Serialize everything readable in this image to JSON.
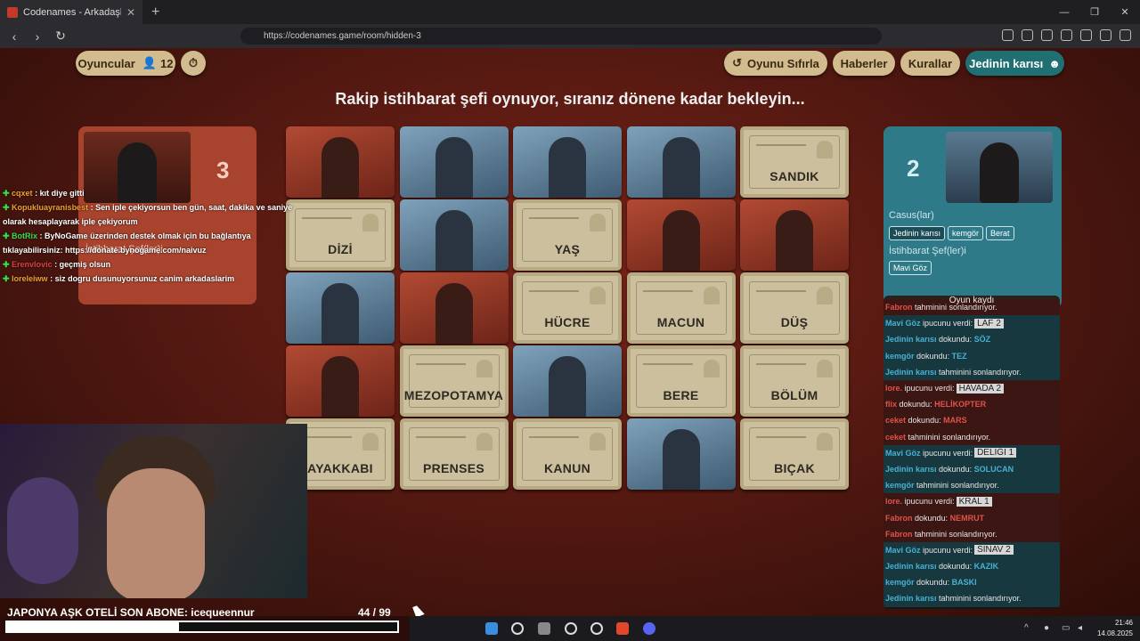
{
  "browser": {
    "tab_title": "Codenames - Arkadaşlarınızla ç",
    "url": "https://codenames.game/room/hidden-3"
  },
  "header": {
    "players_label": "Oyuncular",
    "players_count": "12",
    "reset_label": "Oyunu Sıfırla",
    "news_label": "Haberler",
    "rules_label": "Kurallar",
    "user_label": "Jedinin karısı"
  },
  "status_text": "Rakip istihbarat şefi oynuyor, sıranız dönene kadar bekleyin...",
  "red_team": {
    "count": "3",
    "spymasters_label": "İstihbarat Şef(ler)i"
  },
  "blue_team": {
    "count": "2",
    "operatives_label": "Casus(lar)",
    "operatives": [
      "Jedinin karısı",
      "kemgör",
      "Berat"
    ],
    "spymasters_label": "İstihbarat Şef(ler)i",
    "spymasters": [
      "Mavi Göz"
    ]
  },
  "board": [
    {
      "type": "agent-red",
      "word": ""
    },
    {
      "type": "agent-blue",
      "word": ""
    },
    {
      "type": "agent-blue",
      "word": ""
    },
    {
      "type": "agent-blue",
      "word": ""
    },
    {
      "type": "word",
      "word": "SANDIK"
    },
    {
      "type": "word",
      "word": "DİZİ"
    },
    {
      "type": "agent-blue",
      "word": ""
    },
    {
      "type": "word",
      "word": "YAŞ"
    },
    {
      "type": "agent-red",
      "word": ""
    },
    {
      "type": "agent-red",
      "word": ""
    },
    {
      "type": "agent-blue",
      "word": ""
    },
    {
      "type": "agent-red",
      "word": ""
    },
    {
      "type": "word",
      "word": "HÜCRE"
    },
    {
      "type": "word",
      "word": "MACUN"
    },
    {
      "type": "word",
      "word": "DÜŞ"
    },
    {
      "type": "agent-red",
      "word": ""
    },
    {
      "type": "word",
      "word": "MEZOPOTAMYA"
    },
    {
      "type": "agent-blue",
      "word": ""
    },
    {
      "type": "word",
      "word": "BERE"
    },
    {
      "type": "word",
      "word": "BÖLÜM"
    },
    {
      "type": "word",
      "word": "AYAKKABI"
    },
    {
      "type": "word",
      "word": "PRENSES"
    },
    {
      "type": "word",
      "word": "KANUN"
    },
    {
      "type": "agent-blue",
      "word": ""
    },
    {
      "type": "word",
      "word": "BIÇAK"
    }
  ],
  "log": {
    "title": "Oyun kaydı",
    "rows": [
      {
        "team": "red",
        "player": "Fabron",
        "action": "tahminini sonlandırıyor.",
        "word": "",
        "hint": ""
      },
      {
        "team": "blue",
        "player": "Mavi Göz",
        "action": "ipucunu verdi:",
        "word": "",
        "hint": "LAF 2"
      },
      {
        "team": "blue",
        "player": "Jedinin karısı",
        "action": "dokundu:",
        "word": "SÖZ",
        "hint": ""
      },
      {
        "team": "blue",
        "player": "kemgör",
        "action": "dokundu:",
        "word": "TEZ",
        "hint": ""
      },
      {
        "team": "blue",
        "player": "Jedinin karısı",
        "action": "tahminini sonlandırıyor.",
        "word": "",
        "hint": ""
      },
      {
        "team": "red",
        "player": "lore.",
        "action": "ipucunu verdi:",
        "word": "",
        "hint": "HAVADA 2"
      },
      {
        "team": "red",
        "player": "flix",
        "action": "dokundu:",
        "word": "HELİKOPTER",
        "hint": ""
      },
      {
        "team": "red",
        "player": "ceket",
        "action": "dokundu:",
        "word": "MARS",
        "hint": ""
      },
      {
        "team": "red",
        "player": "ceket",
        "action": "tahminini sonlandırıyor.",
        "word": "",
        "hint": ""
      },
      {
        "team": "blue",
        "player": "Mavi Göz",
        "action": "ipucunu verdi:",
        "word": "",
        "hint": "DELİĞİ 1"
      },
      {
        "team": "blue",
        "player": "Jedinin karısı",
        "action": "dokundu:",
        "word": "SOLUCAN",
        "hint": ""
      },
      {
        "team": "blue",
        "player": "kemgör",
        "action": "tahminini sonlandırıyor.",
        "word": "",
        "hint": ""
      },
      {
        "team": "red",
        "player": "lore.",
        "action": "ipucunu verdi:",
        "word": "",
        "hint": "KRAL 1"
      },
      {
        "team": "red",
        "player": "Fabron",
        "action": "dokundu:",
        "word": "NEMRUT",
        "hint": ""
      },
      {
        "team": "red",
        "player": "Fabron",
        "action": "tahminini sonlandırıyor.",
        "word": "",
        "hint": ""
      },
      {
        "team": "blue",
        "player": "Mavi Göz",
        "action": "ipucunu verdi:",
        "word": "",
        "hint": "SINAV 2"
      },
      {
        "team": "blue",
        "player": "Jedinin karısı",
        "action": "dokundu:",
        "word": "KAZIK",
        "hint": ""
      },
      {
        "team": "blue",
        "player": "kemgör",
        "action": "dokundu:",
        "word": "BASKI",
        "hint": ""
      },
      {
        "team": "blue",
        "player": "Jedinin karısı",
        "action": "tahminini sonlandırıyor.",
        "word": "",
        "hint": ""
      }
    ]
  },
  "chat": [
    {
      "user": "cqxet",
      "text": "kıt diye gitti",
      "color": "#f0a030"
    },
    {
      "user": "Kopukluayranisbest",
      "text": "Sen iple çekiyorsun ben gün, saat, dakika ve saniye olarak hesaplayarak iple çekiyorum",
      "color": "#f0a030"
    },
    {
      "user": "BotRix",
      "text": "ByNoGame üzerinden destek olmak için bu bağlantıya tıklayabilirsiniz: https://donate.bynogame.com/naivuz",
      "color": "#3fdc4a"
    },
    {
      "user": "Erenvlovic",
      "text": "geçmiş olsun",
      "color": "#e04040"
    },
    {
      "user": "loreleiww",
      "text": "siz dogru dusunuyorsunuz canim arkadaslarim",
      "color": "#f0a030"
    }
  ],
  "stream": {
    "ticker": "JAPONYA AŞK OTELİ   SON ABONE: icequeennur",
    "counter": "44  / 99",
    "progress": 0.44
  },
  "taskbar": {
    "time": "21:46",
    "date": "14.08.2025"
  }
}
